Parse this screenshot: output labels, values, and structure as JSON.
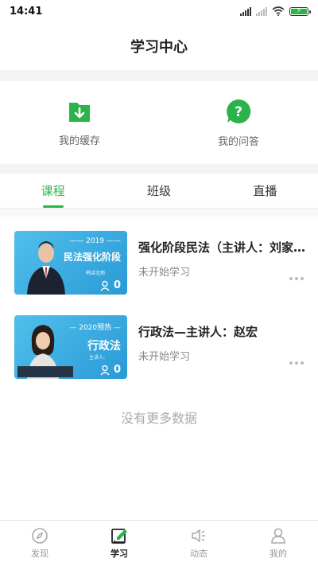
{
  "status_bar": {
    "time": "14:41"
  },
  "header": {
    "title": "学习中心"
  },
  "quick_actions": [
    {
      "label": "我的缓存",
      "icon": "download-icon",
      "color": "#2bb34a"
    },
    {
      "label": "我的问答",
      "icon": "question-icon",
      "color": "#2bb34a"
    }
  ],
  "tabs": [
    {
      "label": "课程",
      "active": true
    },
    {
      "label": "班级",
      "active": false
    },
    {
      "label": "直播",
      "active": false
    }
  ],
  "courses": [
    {
      "name": "强化阶段民法（主讲人：刘家…",
      "status": "未开始学习",
      "thumb": {
        "year": "—— 2019 ——",
        "subject": "民法强化阶段",
        "lecturer": "韩讲北雨",
        "count": "0"
      }
    },
    {
      "name": "行政法—主讲人：赵宏",
      "status": "未开始学习",
      "thumb": {
        "year": "— 2020预热 —",
        "subject": "行政法",
        "lecturer": "主讲人:",
        "count": "0"
      }
    }
  ],
  "no_more_text": "没有更多数据",
  "bottom_nav": [
    {
      "label": "发现",
      "icon": "compass-icon",
      "active": false
    },
    {
      "label": "学习",
      "icon": "study-icon",
      "active": true
    },
    {
      "label": "动态",
      "icon": "speaker-icon",
      "active": false
    },
    {
      "label": "我的",
      "icon": "profile-icon",
      "active": false
    }
  ],
  "colors": {
    "accent": "#2bb34a",
    "thumb_blue": "#3aaee3"
  }
}
